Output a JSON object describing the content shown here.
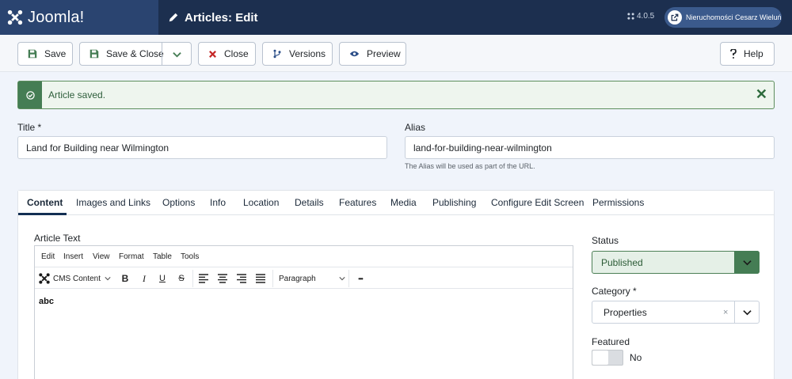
{
  "header": {
    "brand": "Joomla!",
    "page_title": "Articles: Edit",
    "version": "4.0.5",
    "site_button": "Nieruchomości Cesarz Wieluń"
  },
  "toolbar": {
    "save": "Save",
    "save_close": "Save & Close",
    "close": "Close",
    "versions": "Versions",
    "preview": "Preview",
    "help": "Help"
  },
  "alert": {
    "message": "Article saved.",
    "close": "✕"
  },
  "fields": {
    "title_label": "Title *",
    "title_value": "Land for Building near Wilmington",
    "alias_label": "Alias",
    "alias_value": "land-for-building-near-wilmington",
    "alias_hint": "The Alias will be used as part of the URL."
  },
  "tabs": [
    "Content",
    "Images and Links",
    "Options",
    "Info",
    "Location",
    "Details",
    "Features",
    "Media",
    "Publishing",
    "Configure Edit Screen",
    "Permissions"
  ],
  "editor": {
    "label": "Article Text",
    "menu": [
      "Edit",
      "Insert",
      "View",
      "Format",
      "Table",
      "Tools"
    ],
    "cms_content": "CMS Content",
    "bold": "B",
    "italic": "I",
    "underline": "U",
    "strike": "S",
    "block_format": "Paragraph",
    "more": "•••",
    "content": "abc"
  },
  "sidebar": {
    "status_label": "Status",
    "status_value": "Published",
    "category_label": "Category *",
    "category_value": "Properties",
    "category_clear": "×",
    "featured_label": "Featured",
    "featured_value": "No"
  },
  "colors": {
    "header_bg": "#1c2f4f",
    "logo_bg": "#2a4470",
    "success": "#457d54",
    "active_tab": "#132f53",
    "danger": "#c52827"
  },
  "icons": {
    "save": "save-icon",
    "close": "close-icon",
    "versions": "branch-icon",
    "preview": "eye-icon",
    "help": "question-icon",
    "external": "external-link-icon"
  }
}
